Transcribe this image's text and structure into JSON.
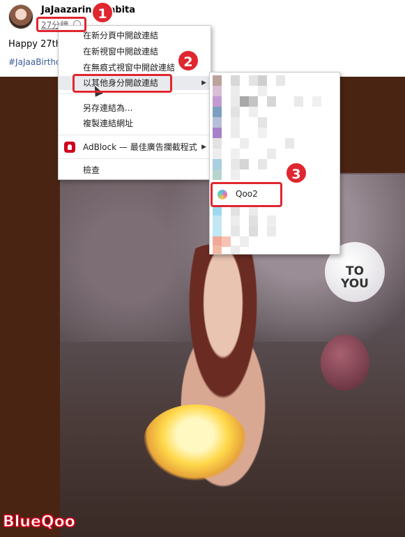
{
  "post": {
    "author": "JaJaazarinn.Habita",
    "timestamp": "27分鐘",
    "text": "Happy 27th",
    "hashtag": "#JaJaaBirthd"
  },
  "context_menu": {
    "items": [
      {
        "label": "在新分頁中開啟連結"
      },
      {
        "label": "在新視窗中開啟連結"
      },
      {
        "label": "在無痕式視窗中開啟連結"
      },
      {
        "label": "以其他身分開啟連結",
        "has_submenu": true,
        "active": true
      },
      {
        "label": "另存連結為..."
      },
      {
        "label": "複製連結網址"
      },
      {
        "label": "AdBlock — 最佳廣告攔截程式",
        "has_submenu": true,
        "icon": "adblock-icon"
      },
      {
        "label": "檢查"
      }
    ]
  },
  "submenu": {
    "highlighted_profile": "Qoo2"
  },
  "photo": {
    "balloon_text": "TO YOU"
  },
  "annotations": {
    "steps": [
      "1",
      "2",
      "3"
    ],
    "highlight_color": "#e0262f"
  },
  "watermark": "BlueQoo"
}
